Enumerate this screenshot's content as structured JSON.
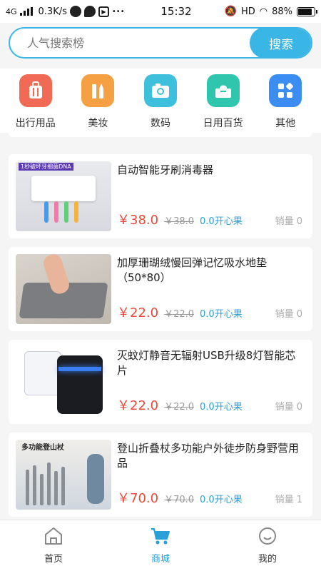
{
  "statusbar": {
    "network": "4G",
    "speed": "0.3K/s",
    "more": "•••",
    "time": "15:32",
    "hd": "HD",
    "battery": "88%",
    "battery_level": 0.88
  },
  "search": {
    "placeholder": "人气搜索榜",
    "button_label": "搜索",
    "accent": "#39b6e6"
  },
  "categories": [
    {
      "label": "出行用品",
      "icon": "luggage-icon",
      "color": "#f06a55"
    },
    {
      "label": "美妆",
      "icon": "lipstick-icon",
      "color": "#f4a043"
    },
    {
      "label": "数码",
      "icon": "camera-icon",
      "color": "#3ec0dc"
    },
    {
      "label": "日用百货",
      "icon": "tissue-box-icon",
      "color": "#2fc6ad"
    },
    {
      "label": "其他",
      "icon": "grid-icon",
      "color": "#3c8df2"
    }
  ],
  "products": [
    {
      "title": "自动智能牙刷消毒器",
      "price": "￥38.0",
      "original": "￥38.0",
      "happy": "0.0开心果",
      "sales": "销量 0",
      "image": "toothbrush-sterilizer-image"
    },
    {
      "title": "加厚珊瑚绒慢回弹记忆吸水地垫（50*80）",
      "price": "￥22.0",
      "original": "￥22.0",
      "happy": "0.0开心果",
      "sales": "销量 0",
      "image": "floor-mat-image"
    },
    {
      "title": "灭蚊灯静音无辐射USB升级8灯智能芯片",
      "price": "￥22.0",
      "original": "￥22.0",
      "happy": "0.0开心果",
      "sales": "销量 0",
      "image": "mosquito-lamp-image"
    },
    {
      "title": "登山折叠杖多功能户外徒步防身野营用品",
      "price": "￥70.0",
      "original": "￥70.0",
      "happy": "0.0开心果",
      "sales": "销量 1",
      "image": "trekking-pole-image"
    }
  ],
  "product_images": {
    "toothbrush_label": "1秒破坏牙细菌DNA",
    "trekking_header": "多功能登山杖"
  },
  "nav": [
    {
      "label": "首页",
      "icon": "home-icon",
      "active": false
    },
    {
      "label": "商城",
      "icon": "cart-icon",
      "active": true
    },
    {
      "label": "我的",
      "icon": "profile-icon",
      "active": false
    }
  ],
  "colors": {
    "price": "#e84b3c",
    "happy": "#2aa0d8",
    "active_nav": "#2aa0d8"
  }
}
